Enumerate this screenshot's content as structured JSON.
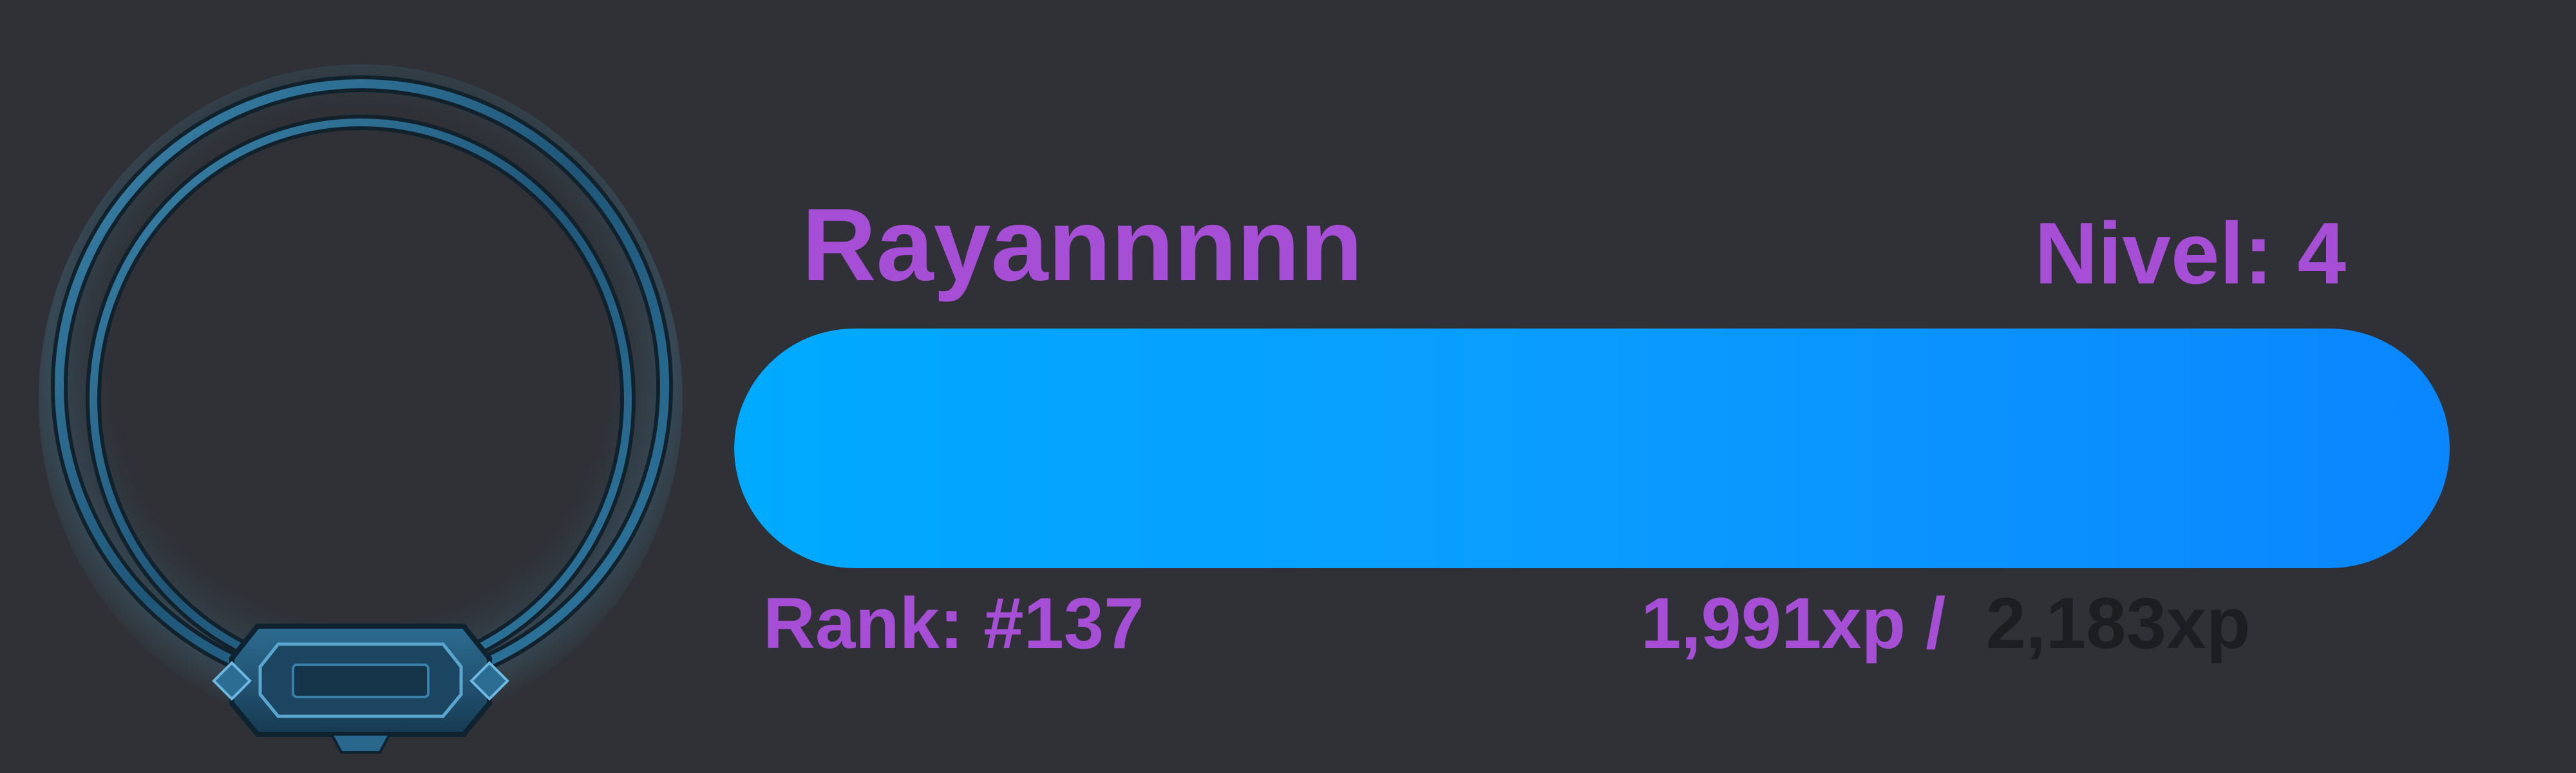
{
  "profile": {
    "username": "Rayannnnn",
    "level_label": "Nivel: 4",
    "rank_label": "Rank: #137"
  },
  "xp": {
    "current_label": "1,991xp",
    "separator": "/",
    "total_label": "2,183xp",
    "progress_fraction": 1.0
  },
  "colors": {
    "background": "#2f3136",
    "text_accent": "#a64fd6",
    "bar_fill_start": "#00aaff",
    "bar_fill_end": "#0a86ff",
    "frame_ring": "#2b6c92",
    "xp_total_text": "#1c1e22"
  },
  "icons": {
    "avatar_frame": "ornate-ring-frame-icon"
  }
}
